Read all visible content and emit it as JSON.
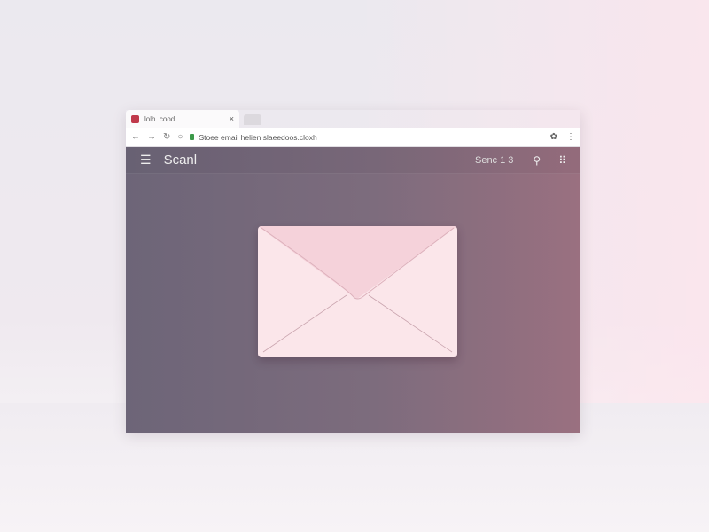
{
  "tab": {
    "title": "lolh. cood",
    "close": "×"
  },
  "address": {
    "url": "Stoee email helien slaeedoos.cloxh"
  },
  "app": {
    "menu_icon": "☰",
    "title": "Scanl",
    "selector": "Senc 1 3",
    "search_icon": "⚲",
    "grid_icon": "⠿"
  },
  "nav": {
    "back": "←",
    "forward": "→",
    "reload": "↻",
    "home": "○"
  },
  "addr_icons": {
    "extension": "✿",
    "more": "⋮"
  }
}
